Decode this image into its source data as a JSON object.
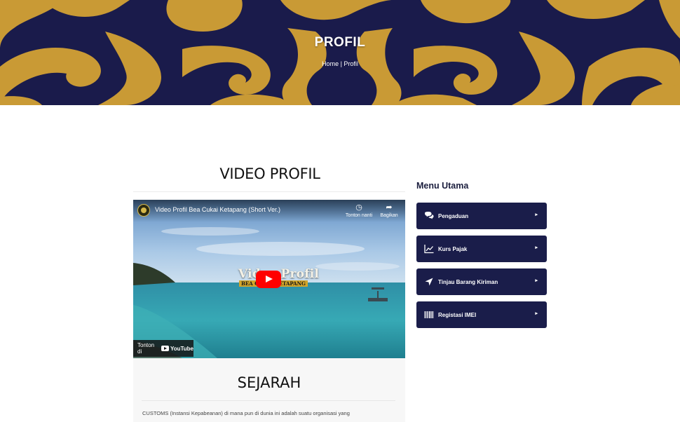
{
  "banner": {
    "title": "PROFIL",
    "breadcrumb": {
      "home": "Home",
      "separator": " | ",
      "current": "Profil"
    },
    "colors": {
      "navy": "#1a1b4b",
      "gold": "#c99a35"
    }
  },
  "video_section": {
    "heading": "VIDEO PROFIL",
    "player": {
      "title": "Video Profil Bea Cukai Ketapang (Short Ver.)",
      "watch_later": "Tonton nanti",
      "share": "Bagikan",
      "overlay_title": "Video Profil",
      "overlay_subtitle": "BEA CUKAI KETAPANG",
      "watch_on": "Tonton di",
      "platform": "YouTube"
    }
  },
  "sejarah": {
    "heading": "SEJARAH",
    "text": "CUSTOMS (Instansi Kepabeanan) di mana pun di dunia ini adalah suatu organisasi yang"
  },
  "sidebar": {
    "heading": "Menu Utama",
    "items": [
      {
        "label": "Pengaduan",
        "icon": "comments-icon"
      },
      {
        "label": "Kurs Pajak",
        "icon": "chart-line-icon"
      },
      {
        "label": "Tinjau Barang Kiriman",
        "icon": "location-arrow-icon"
      },
      {
        "label": "Registasi IMEI",
        "icon": "barcode-icon"
      }
    ],
    "accent": "#1a1d4a"
  }
}
